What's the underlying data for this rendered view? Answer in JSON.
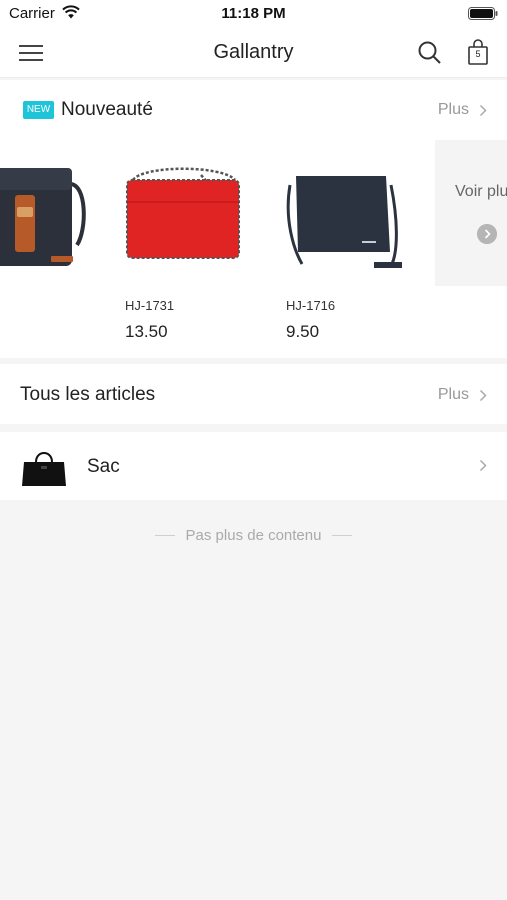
{
  "status_bar": {
    "carrier": "Carrier",
    "time": "11:18 PM"
  },
  "nav": {
    "title": "Gallantry",
    "cart_count": "5"
  },
  "new_section": {
    "badge": "NEW",
    "title": "Nouveauté",
    "more_label": "Plus",
    "products": [
      {
        "code": "",
        "price": "",
        "color": "#2b303a"
      },
      {
        "code": "HJ-1731",
        "price": "13.50",
        "color": "#e02424"
      },
      {
        "code": "HJ-1716",
        "price": "9.50",
        "color": "#2c3340"
      }
    ],
    "see_more": "Voir plus"
  },
  "all_section": {
    "title": "Tous les articles",
    "more_label": "Plus"
  },
  "categories": [
    {
      "label": "Sac"
    }
  ],
  "footer": {
    "end_text": "Pas plus de contenu"
  },
  "colors": {
    "accent": "#1ec5d8",
    "background": "#f5f5f5",
    "secondary_text": "#999999"
  }
}
